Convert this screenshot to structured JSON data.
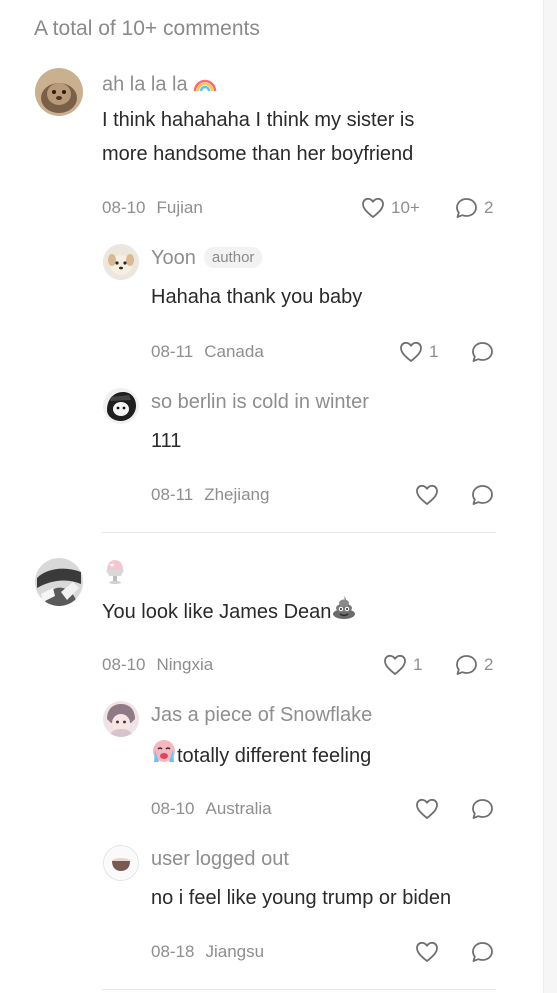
{
  "header": {
    "total": "A total of 10+ comments"
  },
  "comments": [
    {
      "user": "ah la la la",
      "text_lines": [
        "I think hahahaha I think my sister is",
        "more handsome than her boyfriend"
      ],
      "date": "08-10",
      "location": "Fujian",
      "likes": "10+",
      "replies": "2"
    },
    {
      "user": "Yoon",
      "badge": "author",
      "text": "Hahaha thank you baby",
      "date": "08-11",
      "location": "Canada",
      "likes": "1"
    },
    {
      "user": "so berlin is cold in winter",
      "text": "111",
      "date": "08-11",
      "location": "Zhejiang"
    },
    {
      "user": "",
      "text": "You look like James Dean",
      "date": "08-10",
      "location": "Ningxia",
      "likes": "1",
      "replies": "2"
    },
    {
      "user": "Jas a piece of Snowflake",
      "text": "totally different feeling",
      "date": "08-10",
      "location": "Australia"
    },
    {
      "user": "user logged out",
      "text": "no i feel like young trump or biden",
      "date": "08-18",
      "location": "Jiangsu"
    }
  ],
  "icons": {
    "like": "heart-outline-icon",
    "reply": "speech-bubble-icon",
    "user1_emoji": "rainbow-emoji",
    "user4_emoji": "shaved-ice-emoji",
    "comment4_emoji": "poop-emoji",
    "comment5_emoji": "crying-emoji"
  },
  "colors": {
    "text": "#2a2a2a",
    "muted": "#8e8e8e",
    "badge_bg": "#f2f2f2"
  }
}
